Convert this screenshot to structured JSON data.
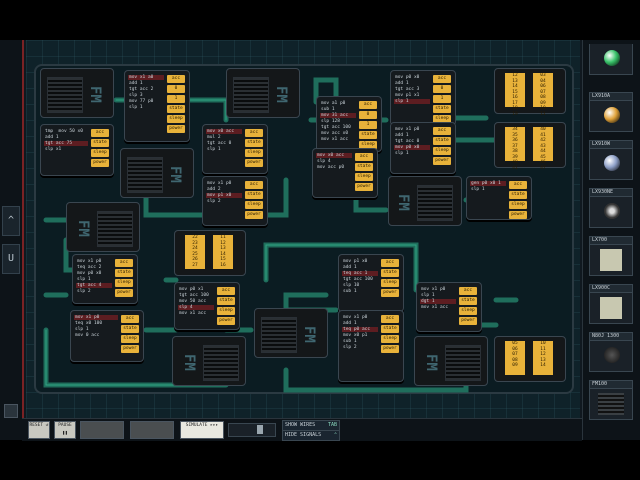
{
  "left_tabs": [
    {
      "label": "^"
    },
    {
      "label": "U"
    }
  ],
  "sidebar": {
    "items": [
      {
        "label": "",
        "kind": "led",
        "color": "#39c36a"
      },
      {
        "label": "LX910A",
        "kind": "led",
        "color": "#e0a23a"
      },
      {
        "label": "LX910W",
        "kind": "led",
        "color": "#8ea0c8"
      },
      {
        "label": "LX930NE",
        "kind": "knob",
        "color": "#c8d0d6"
      },
      {
        "label": "LX700",
        "kind": "panel",
        "color": "#c8c8b0"
      },
      {
        "label": "LX900C",
        "kind": "panel",
        "color": "#c8c8b0"
      },
      {
        "label": "N80J 1300",
        "kind": "speaker",
        "color": "#222"
      },
      {
        "label": "FM100",
        "kind": "fm",
        "color": "#333"
      }
    ]
  },
  "bottom": {
    "buttons": [
      {
        "label": "RESET\n↺"
      },
      {
        "label": "PAUSE\n❚❚"
      },
      {
        "label": ""
      },
      {
        "label": ""
      },
      {
        "label": "SIMULATE\n▸▸▸"
      }
    ],
    "toggles": [
      {
        "label": "SHOW WIRES",
        "key": "TAB"
      },
      {
        "label": "HIDE SIGNALS",
        "key": "⌃"
      }
    ]
  },
  "chips": [
    {
      "lines": [
        "mov x1 a0",
        "add 1",
        "tgt acc 2",
        "slp 3",
        "mov 77 p0",
        "slp 1"
      ],
      "buttons": [
        "acc",
        "0",
        "1",
        "state",
        "sleep",
        "power"
      ]
    },
    {
      "lines": [
        "mov a1 p0",
        "sub 1",
        "mov 31 acc",
        "slp 128",
        "tgt acc 100",
        "mov acc x0",
        "mov x1 acc"
      ],
      "buttons": [
        "acc",
        "0",
        "1",
        "state",
        "sleep",
        "power"
      ]
    },
    {
      "lines": [
        "mov p0 x0",
        "add 1",
        "tgt acc 3",
        "mov p1 x1",
        "slp 1"
      ],
      "buttons": [
        "acc",
        "0",
        "1",
        "state",
        "sleep",
        "power"
      ]
    },
    {
      "lines": [
        "tmp  mov 50 x0",
        "add 1",
        "tgt acc 75",
        "slp x1"
      ],
      "buttons": [
        "acc",
        "state",
        "sleep",
        "power"
      ]
    },
    {
      "lines": [
        "mov x0 acc",
        "mul 2",
        "tgt acc 0",
        "slp 1"
      ],
      "buttons": [
        "acc",
        "state",
        "sleep",
        "power"
      ]
    },
    {
      "lines": [
        "mov x1 p0",
        "add 2",
        "mov p1 x0",
        "slp 2"
      ],
      "buttons": [
        "acc",
        "state",
        "sleep",
        "power"
      ]
    },
    {
      "lines": [
        "mov x0 acc",
        "slp 4",
        "mov acc p0"
      ],
      "buttons": [
        "acc",
        "state",
        "sleep",
        "power"
      ]
    },
    {
      "lines": [
        "gen p0 x0 1",
        "slp 1"
      ],
      "buttons": [
        "acc",
        "state",
        "sleep",
        "power"
      ]
    },
    {
      "lines": [
        "mov x1 p0",
        "teq acc 2",
        "mov p0 x0",
        "slp 1",
        "tgt acc 4",
        "slp 2"
      ],
      "buttons": [
        "acc",
        "state",
        "sleep",
        "power"
      ]
    },
    {
      "lines": [
        "mov p0 x1",
        "tgt acc 100",
        "mov 50 acc",
        "slp 4",
        "mov x1 acc"
      ],
      "buttons": [
        "acc",
        "state",
        "sleep",
        "power"
      ]
    },
    {
      "lines": [
        "mov p1 x0",
        "add 1",
        "teq acc 1",
        "tgt acc 100",
        "slp 10",
        "sub 1"
      ],
      "buttons": [
        "acc",
        "state",
        "sleep",
        "power"
      ]
    },
    {
      "lines": [
        "mov x1 p0",
        "slp 1",
        "dgt 1",
        "mov x1 acc"
      ],
      "buttons": [
        "acc",
        "state",
        "sleep",
        "power"
      ]
    },
    {
      "lines": [
        "mov x1 p0",
        "teq x0 100",
        "slp 1",
        "mov 0 acc"
      ],
      "buttons": [
        "acc",
        "state",
        "sleep",
        "power"
      ]
    },
    {
      "lines": [
        "mov x1 p0",
        "add 1",
        "teq p0 acc",
        "mov x0 p1",
        "sub 1",
        "slp 2"
      ],
      "buttons": [
        "acc",
        "state",
        "sleep",
        "power"
      ]
    },
    {
      "lines": [
        "mov x1 p0",
        "add 1",
        "tgt acc 0",
        "mov p0 x0",
        "slp 1"
      ],
      "buttons": [
        "acc",
        "state",
        "sleep",
        "power"
      ]
    }
  ],
  "ram_tables": [
    {
      "cols": [
        "12\n13\n14\n15\n16\n17\n18\n19",
        "03\n04\n06\n07\n08\n09\n10\n11"
      ]
    },
    {
      "cols": [
        "34\n35\n36\n37\n38\n39\n40\n41",
        "40\n41\n42\n43\n44\n45\n46\n47"
      ]
    },
    {
      "cols": [
        "22\n23\n24\n25\n26\n27",
        "11\n12\n13\n14\n15\n16"
      ]
    },
    {
      "cols": [
        "05\n06\n07\n08\n09",
        "10\n11\n12\n13\n14"
      ]
    }
  ],
  "fm_label": "FM"
}
